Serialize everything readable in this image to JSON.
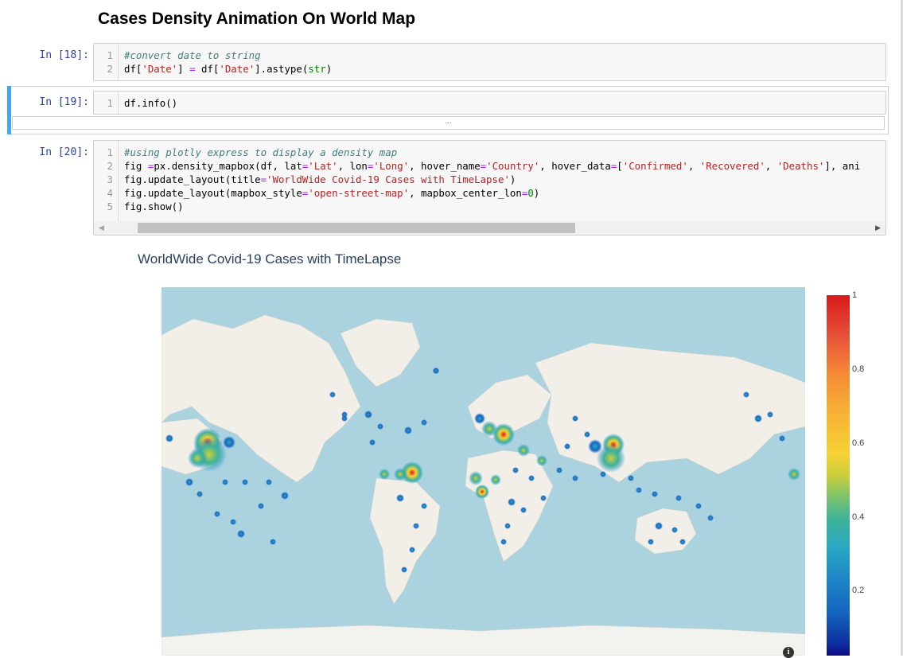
{
  "notebook": {
    "heading": "Cases Density Animation On World Map",
    "cells": [
      {
        "prompt": "In [18]:",
        "lines": [
          {
            "n": "1",
            "tokens": [
              {
                "c": "cm",
                "t": "#convert date to string"
              }
            ]
          },
          {
            "n": "2",
            "tokens": [
              {
                "c": "",
                "t": "df["
              },
              {
                "c": "st",
                "t": "'Date'"
              },
              {
                "c": "",
                "t": "] "
              },
              {
                "c": "op",
                "t": "="
              },
              {
                "c": "",
                "t": " df["
              },
              {
                "c": "st",
                "t": "'Date'"
              },
              {
                "c": "",
                "t": "].astype("
              },
              {
                "c": "nb",
                "t": "str"
              },
              {
                "c": "",
                "t": ")"
              }
            ]
          }
        ]
      },
      {
        "prompt": "In [19]:",
        "collapsed_output": "...",
        "lines": [
          {
            "n": "1",
            "tokens": [
              {
                "c": "",
                "t": "df.info()"
              }
            ]
          }
        ]
      },
      {
        "prompt": "In [20]:",
        "lines": [
          {
            "n": "1",
            "tokens": [
              {
                "c": "cm",
                "t": "#using plotly express to display a density map"
              }
            ]
          },
          {
            "n": "2",
            "tokens": [
              {
                "c": "",
                "t": "fig "
              },
              {
                "c": "op",
                "t": "="
              },
              {
                "c": "",
                "t": "px.density_mapbox(df, lat"
              },
              {
                "c": "op",
                "t": "="
              },
              {
                "c": "st",
                "t": "'Lat'"
              },
              {
                "c": "",
                "t": ", lon"
              },
              {
                "c": "op",
                "t": "="
              },
              {
                "c": "st",
                "t": "'Long'"
              },
              {
                "c": "",
                "t": ", hover_name"
              },
              {
                "c": "op",
                "t": "="
              },
              {
                "c": "st",
                "t": "'Country'"
              },
              {
                "c": "",
                "t": ", hover_data"
              },
              {
                "c": "op",
                "t": "="
              },
              {
                "c": "",
                "t": "["
              },
              {
                "c": "st",
                "t": "'Confirmed'"
              },
              {
                "c": "",
                "t": ", "
              },
              {
                "c": "st",
                "t": "'Recovered'"
              },
              {
                "c": "",
                "t": ", "
              },
              {
                "c": "st",
                "t": "'Deaths'"
              },
              {
                "c": "",
                "t": "], ani"
              }
            ]
          },
          {
            "n": "3",
            "tokens": [
              {
                "c": "",
                "t": "fig.update_layout(title"
              },
              {
                "c": "op",
                "t": "="
              },
              {
                "c": "st",
                "t": "'WorldWide Covid-19 Cases with TimeLapse'"
              },
              {
                "c": "",
                "t": ")"
              }
            ]
          },
          {
            "n": "4",
            "tokens": [
              {
                "c": "",
                "t": "fig.update_layout(mapbox_style"
              },
              {
                "c": "op",
                "t": "="
              },
              {
                "c": "st",
                "t": "'open-street-map'"
              },
              {
                "c": "",
                "t": ", mapbox_center_lon"
              },
              {
                "c": "op",
                "t": "="
              },
              {
                "c": "nb",
                "t": "0"
              },
              {
                "c": "",
                "t": ")"
              }
            ]
          },
          {
            "n": "5",
            "tokens": [
              {
                "c": "",
                "t": "fig.show()"
              }
            ]
          }
        ]
      }
    ]
  },
  "plot": {
    "title": "WorldWide Covid-19 Cases with TimeLapse",
    "colorbar_ticks": [
      "1",
      "0.8",
      "0.6",
      "0.4",
      "0.2"
    ],
    "colorbar_range": [
      0,
      1
    ],
    "colors": {
      "water": "#aad3df",
      "land": "#f2efe9",
      "ice": "#f2f2ee",
      "high": "#d7191c",
      "mid": "#f6d234",
      "low": "#1e88c7"
    }
  }
}
